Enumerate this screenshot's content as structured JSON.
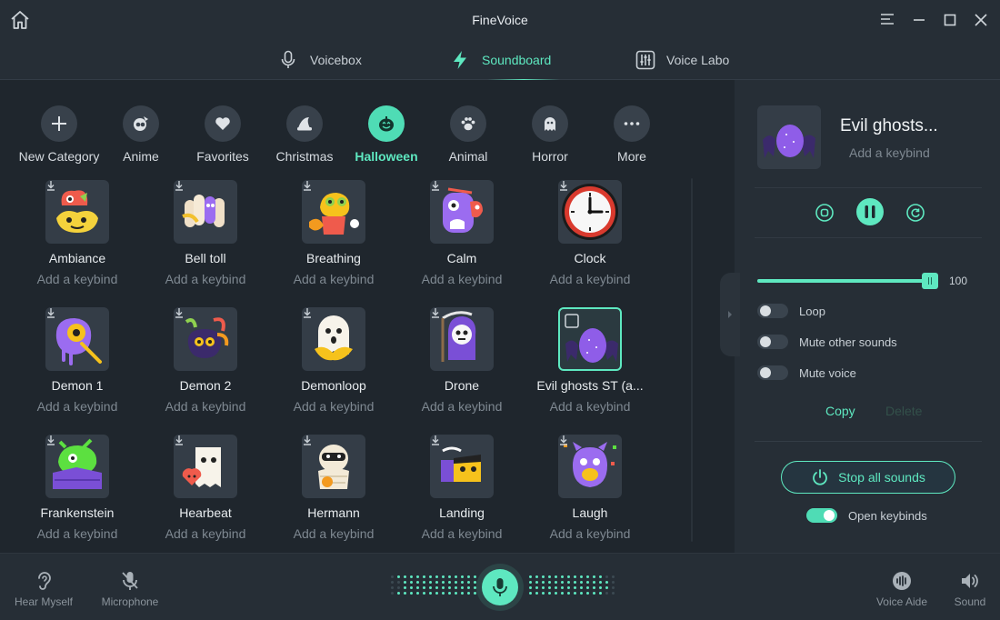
{
  "window": {
    "title": "FineVoice"
  },
  "tabs": [
    {
      "label": "Voicebox",
      "icon": "microphone-icon",
      "active": false
    },
    {
      "label": "Soundboard",
      "icon": "lightning-icon",
      "active": true
    },
    {
      "label": "Voice Labo",
      "icon": "equalizer-icon",
      "active": false
    }
  ],
  "categories": [
    {
      "label": "New Category",
      "icon": "plus-icon"
    },
    {
      "label": "Anime",
      "icon": "anime-icon"
    },
    {
      "label": "Favorites",
      "icon": "heart-icon"
    },
    {
      "label": "Christmas",
      "icon": "christmas-hat-icon"
    },
    {
      "label": "Halloween",
      "icon": "pumpkin-icon",
      "active": true
    },
    {
      "label": "Animal",
      "icon": "paw-icon"
    },
    {
      "label": "Horror",
      "icon": "ghost-icon"
    },
    {
      "label": "More",
      "icon": "more-icon"
    }
  ],
  "sounds": [
    {
      "name": "Ambiance",
      "keybind": "Add a keybind"
    },
    {
      "name": "Bell toll",
      "keybind": "Add a keybind"
    },
    {
      "name": "Breathing",
      "keybind": "Add a keybind"
    },
    {
      "name": "Calm",
      "keybind": "Add a keybind"
    },
    {
      "name": "Clock",
      "keybind": "Add a keybind"
    },
    {
      "name": "Demon 1",
      "keybind": "Add a keybind"
    },
    {
      "name": "Demon 2",
      "keybind": "Add a keybind"
    },
    {
      "name": "Demonloop",
      "keybind": "Add a keybind"
    },
    {
      "name": "Drone",
      "keybind": "Add a keybind"
    },
    {
      "name": "Evil ghosts   ST (a...",
      "keybind": "Add a keybind",
      "selected": true
    },
    {
      "name": "Frankenstein",
      "keybind": "Add a keybind"
    },
    {
      "name": "Hearbeat",
      "keybind": "Add a keybind"
    },
    {
      "name": "Hermann",
      "keybind": "Add a keybind"
    },
    {
      "name": "Landing",
      "keybind": "Add a keybind"
    },
    {
      "name": "Laugh",
      "keybind": "Add a keybind"
    }
  ],
  "now_playing": {
    "title": "Evil ghosts...",
    "keybind": "Add a keybind",
    "volume": 100,
    "toggles": [
      {
        "label": "Loop",
        "on": false
      },
      {
        "label": "Mute other sounds",
        "on": false
      },
      {
        "label": "Mute voice",
        "on": false
      }
    ],
    "copy_label": "Copy",
    "delete_label": "Delete",
    "stop_label": "Stop all sounds",
    "open_keybinds_label": "Open keybinds",
    "open_keybinds_on": true
  },
  "bottom": {
    "hear_myself": "Hear Myself",
    "microphone": "Microphone",
    "voice_aide": "Voice Aide",
    "sound": "Sound"
  },
  "colors": {
    "accent": "#5ee8c0",
    "background": "#262e36",
    "content_bg": "#1f262d",
    "tile_bg": "#343d47"
  }
}
